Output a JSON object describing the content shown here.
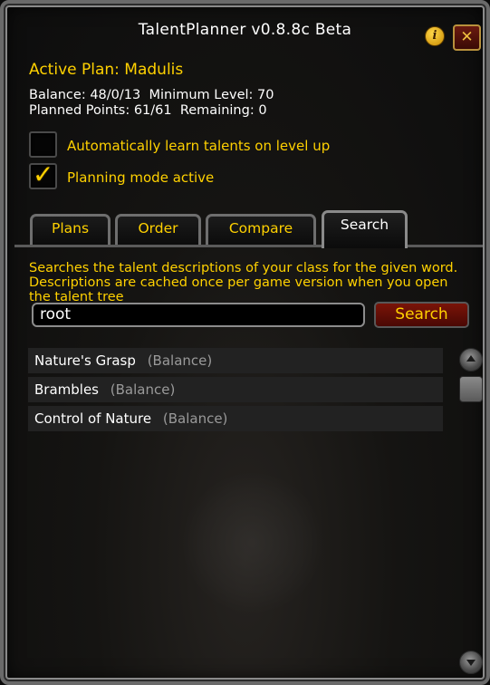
{
  "window": {
    "title": "TalentPlanner v0.8.8c Beta",
    "info_icon": "info-icon",
    "close_icon": "close-icon"
  },
  "plan": {
    "title": "Active Plan: Madulis",
    "balance_line": "Balance: 48/0/13  Minimum Level: 70",
    "points_line": "Planned Points: 61/61  Remaining: 0"
  },
  "options": {
    "auto_learn": {
      "label": "Automatically learn talents on level up",
      "checked": false
    },
    "planning_mode": {
      "label": "Planning mode active",
      "checked": true,
      "checkmark": "✓"
    }
  },
  "tabs": [
    {
      "label": "Plans",
      "active": false
    },
    {
      "label": "Order",
      "active": false
    },
    {
      "label": "Compare",
      "active": false
    },
    {
      "label": "Search",
      "active": true
    }
  ],
  "search": {
    "description": "Searches the talent descriptions of your class for the given word. Descriptions are cached once per game version when you open the talent tree",
    "query": "root",
    "button_label": "Search",
    "results": [
      {
        "name": "Nature's Grasp",
        "tree": "(Balance)"
      },
      {
        "name": "Brambles",
        "tree": "(Balance)"
      },
      {
        "name": "Control of Nature",
        "tree": "(Balance)"
      }
    ]
  },
  "colors": {
    "gold": "#ffd100",
    "white": "#ffffff",
    "tree_gray": "#9a9a9a",
    "button_red": "#7a1408"
  }
}
